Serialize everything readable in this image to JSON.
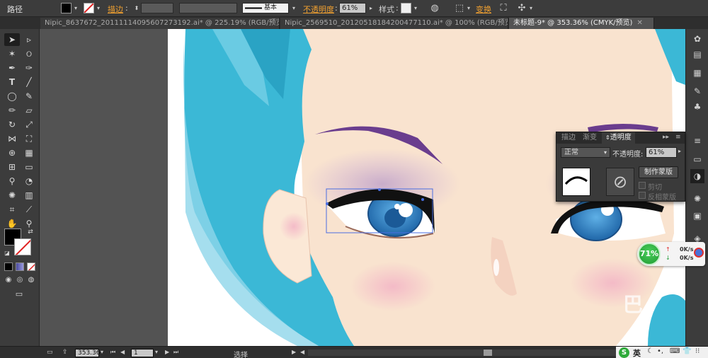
{
  "control_bar": {
    "path_label": "路径",
    "stroke_label": "描边",
    "stroke_weight_preset": "基本",
    "opacity_label": "不透明度",
    "opacity_value": "61%",
    "style_label": "样式",
    "transform_label": "变换"
  },
  "tabs": [
    {
      "label": "Nipic_8637672_20111114095607273192.ai* @ 225.19% (RGB/预览)"
    },
    {
      "label": "Nipic_2569510_20120518184200477110.ai* @ 100% (RGB/预览)"
    },
    {
      "label": "未标题-9* @ 353.36% (CMYK/预览)"
    }
  ],
  "transparency_panel": {
    "tabs": [
      "描边",
      "渐变",
      "透明度"
    ],
    "blend_mode": "正常",
    "opacity_label": "不透明度",
    "opacity_value": "61%",
    "make_mask_label": "制作蒙版",
    "clip_label": "剪切",
    "invert_mask_label": "反相蒙版"
  },
  "network_monitor": {
    "percent": "71%",
    "upload": "0K/s",
    "download": "0K/s"
  },
  "status_bar": {
    "zoom": "353.36",
    "artboard": "1",
    "tool_status": "选择"
  },
  "ime": {
    "lang": "英"
  },
  "colors": {
    "hair": "#3bb8d6",
    "skin": "#f9e3cf",
    "iris": "#2f7fbf",
    "brow": "#6a3d8e",
    "accent_orange": "#f0a030"
  }
}
